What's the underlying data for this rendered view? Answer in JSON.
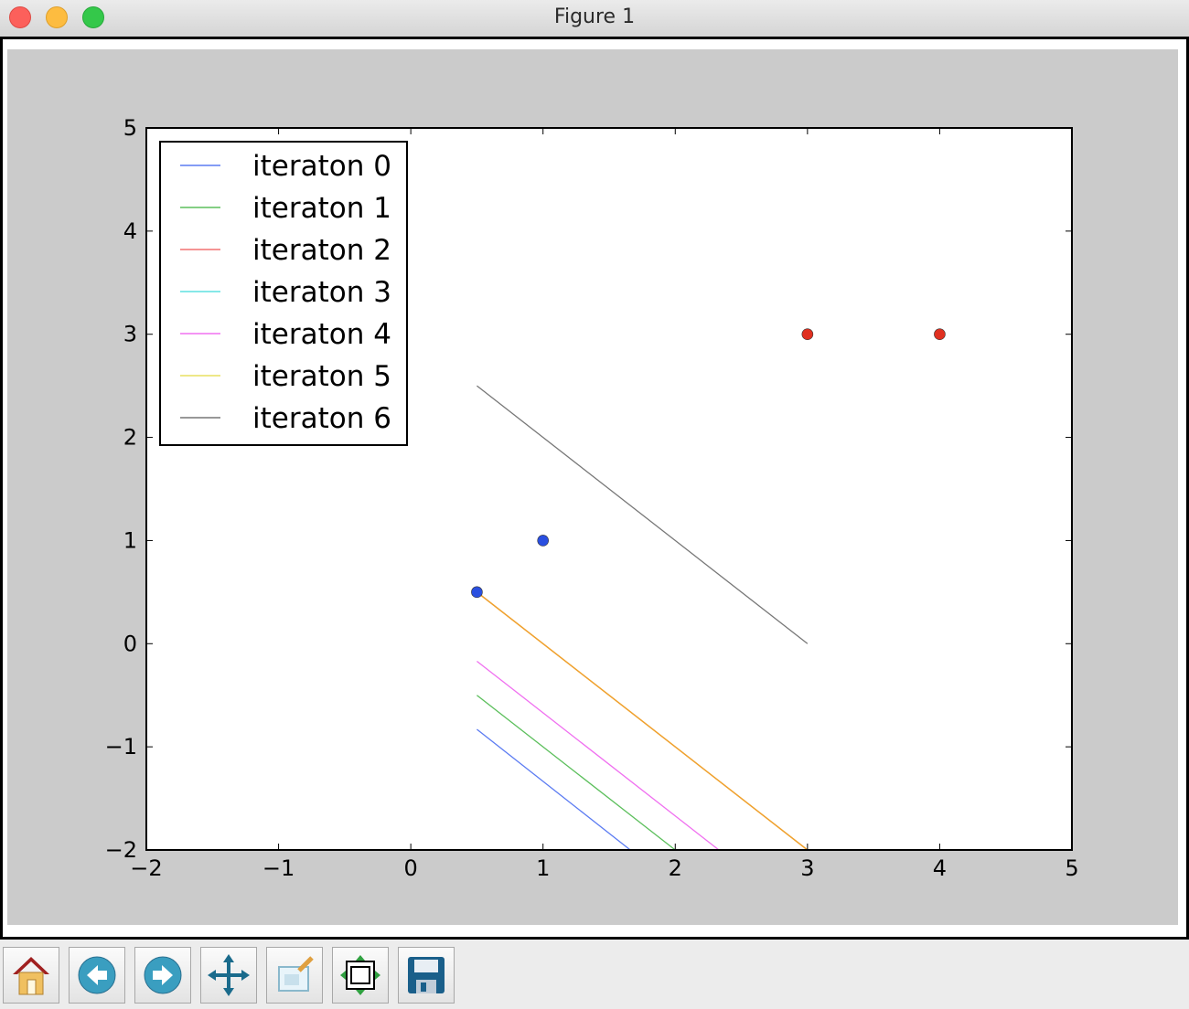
{
  "window": {
    "title": "Figure 1"
  },
  "colors": {
    "figure_background": "#cbcbcb",
    "blue": "#2a4fe0",
    "red": "#e03020",
    "iteration_colors": [
      "#5b7bf2",
      "#5cbf5c",
      "#f27070",
      "#5ee0e0",
      "#f070f0",
      "#e8e060",
      "#777777"
    ],
    "orange_line": "#f0a030"
  },
  "toolbar": {
    "buttons": [
      {
        "name": "home-button",
        "icon": "home-icon"
      },
      {
        "name": "back-button",
        "icon": "back-arrow-icon"
      },
      {
        "name": "forward-button",
        "icon": "forward-arrow-icon"
      },
      {
        "name": "pan-button",
        "icon": "pan-arrows-icon"
      },
      {
        "name": "zoom-button",
        "icon": "zoom-rect-icon"
      },
      {
        "name": "subplots-button",
        "icon": "subplots-icon"
      },
      {
        "name": "save-button",
        "icon": "floppy-disk-icon"
      }
    ]
  },
  "chart_data": {
    "type": "line",
    "title": "",
    "xlabel": "",
    "ylabel": "",
    "xlim": [
      -2,
      5
    ],
    "ylim": [
      -2,
      5
    ],
    "xticks": [
      -2,
      -1,
      0,
      1,
      2,
      3,
      4,
      5
    ],
    "yticks": [
      -2,
      -1,
      0,
      1,
      2,
      3,
      4,
      5
    ],
    "xtick_labels": [
      "−2",
      "−1",
      "0",
      "1",
      "2",
      "3",
      "4",
      "5"
    ],
    "ytick_labels": [
      "−2",
      "−1",
      "0",
      "1",
      "2",
      "3",
      "4",
      "5"
    ],
    "grid": false,
    "legend_position": "top-left",
    "series": [
      {
        "name": "iteraton 0",
        "color": "#5b7bf2",
        "x": [
          0.5,
          1.66
        ],
        "y": [
          -0.83,
          -2.0
        ]
      },
      {
        "name": "iteraton 1",
        "color": "#5cbf5c",
        "x": [
          0.5,
          2.0
        ],
        "y": [
          -0.5,
          -2.0
        ]
      },
      {
        "name": "iteraton 2",
        "color": "#f27070",
        "x": [],
        "y": []
      },
      {
        "name": "iteraton 3",
        "color": "#5ee0e0",
        "x": [],
        "y": []
      },
      {
        "name": "iteraton 4",
        "color": "#f070f0",
        "x": [
          0.5,
          2.33
        ],
        "y": [
          -0.17,
          -2.0
        ]
      },
      {
        "name": "iteraton 5",
        "color": "#e8e060",
        "x": [
          0.5,
          3.0
        ],
        "y": [
          0.5,
          -2.0
        ]
      },
      {
        "name": "iteraton 6",
        "color": "#777777",
        "x": [
          0.5,
          3.0
        ],
        "y": [
          2.5,
          0.0
        ]
      }
    ],
    "overlay_lines": [
      {
        "color": "#f0a030",
        "x": [
          0.5,
          3.0
        ],
        "y": [
          0.5,
          -2.0
        ]
      }
    ],
    "points": [
      {
        "x": 0.5,
        "y": 0.5,
        "color": "#2a4fe0"
      },
      {
        "x": 1,
        "y": 1,
        "color": "#2a4fe0"
      },
      {
        "x": 3,
        "y": 3,
        "color": "#e03020"
      },
      {
        "x": 4,
        "y": 3,
        "color": "#e03020"
      }
    ]
  }
}
